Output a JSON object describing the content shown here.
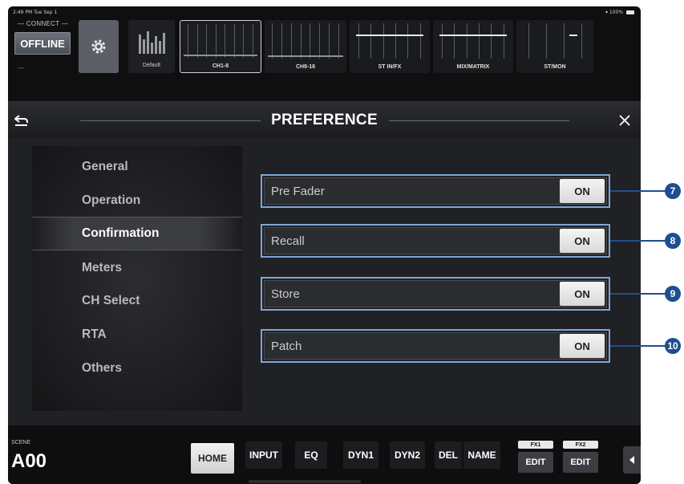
{
  "status_bar": {
    "time": "2:49 PM  Tue Sep 1",
    "battery": "100%"
  },
  "top_bar": {
    "connect_label": "— CONNECT —",
    "offline_button": "OFFLINE",
    "offline_sub": "---",
    "default_label": "Default",
    "banks": [
      {
        "label": "CH1-8",
        "selected": true
      },
      {
        "label": "CH9-16",
        "selected": false
      },
      {
        "label": "ST IN/FX",
        "selected": false
      },
      {
        "label": "MIX/MATRIX",
        "selected": false
      },
      {
        "label": "ST/MON",
        "selected": false
      }
    ]
  },
  "panel": {
    "title": "PREFERENCE",
    "sidebar": [
      "General",
      "Operation",
      "Confirmation",
      "Meters",
      "CH Select",
      "RTA",
      "Others"
    ],
    "active_sidebar_index": 2,
    "rows": [
      {
        "label": "Pre Fader",
        "value": "ON",
        "callout": "7"
      },
      {
        "label": "Recall",
        "value": "ON",
        "callout": "8"
      },
      {
        "label": "Store",
        "value": "ON",
        "callout": "9"
      },
      {
        "label": "Patch",
        "value": "ON",
        "callout": "10"
      }
    ]
  },
  "bottom_bar": {
    "scene_label": "SCENE",
    "scene_name": "A00",
    "home": "HOME",
    "tabs": [
      "INPUT",
      "EQ",
      "DYN1",
      "DYN2",
      "DEL",
      "NAME"
    ],
    "fx": [
      {
        "tag": "FX1",
        "edit": "EDIT"
      },
      {
        "tag": "FX2",
        "edit": "EDIT"
      }
    ]
  },
  "colors": {
    "callout": "#1f4e8f",
    "row_highlight": "#7fa6d8",
    "background": "#0f0f10"
  }
}
